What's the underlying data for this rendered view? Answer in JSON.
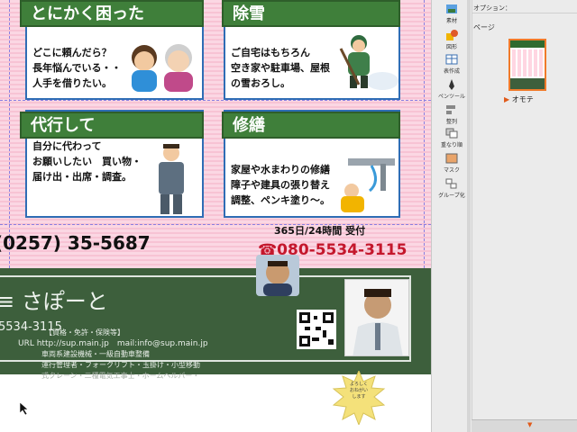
{
  "cards": [
    {
      "title": "とにかく困った",
      "text": "どこに頼んだら？\n長年悩んでいる・・\n人手を借りたい。"
    },
    {
      "title": "除雪",
      "text": "ご自宅はもちろん\n空き家や駐車場、屋根\nの雪おろし。"
    },
    {
      "title": "代行して",
      "text": "自分に代わって\nお願いしたい　買い物・\n届け出・出席・調査。"
    },
    {
      "title": "修繕",
      "text": "家屋や水まわりの修繕\n障子や建具の張り替え\n調整、ペンキ塗り～。"
    }
  ],
  "contact": {
    "phone_main": "(0257) 35-5687",
    "hours": "365日/24時間 受付",
    "mobile": "☎080-5534-3115"
  },
  "company": {
    "name": "さぽーと",
    "phone_partial": "5534-3115",
    "url_line": "URL http://sup.main.jp　mail:info@sup.main.jp",
    "qual_header": "【資格・免許・保険等】",
    "qual_lines": [
      "車両系建設機械・一級自動車整備",
      "運行管理者・フォークリフト・玉掛け・小型移動",
      "式クレーン・二種電気工事士・ホームヘルパー・"
    ]
  },
  "badge": "よろしく\nおねがい\nします",
  "panel": {
    "options_label": "オプション：",
    "pages_label": "ページ",
    "page_name": "オモテ",
    "tools": [
      "素材",
      "図形",
      "表作成",
      "ペンツール",
      "整列",
      "重なり順",
      "マスク",
      "グループ化"
    ]
  }
}
